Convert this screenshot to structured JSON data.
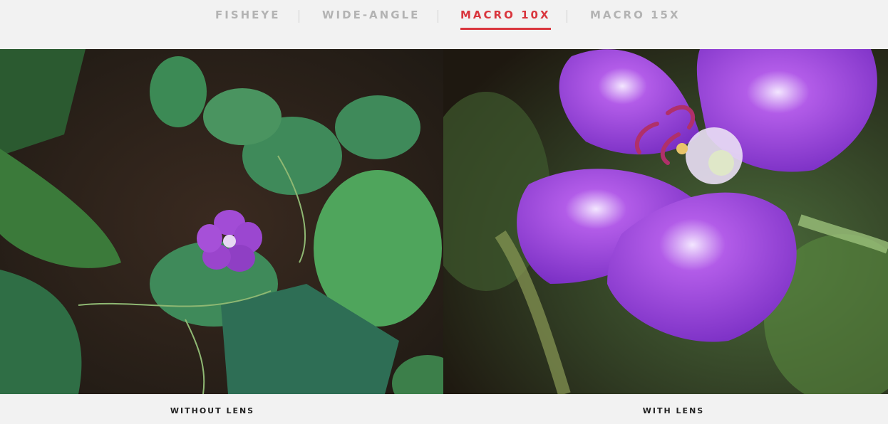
{
  "tabs": [
    {
      "label": "FISHEYE",
      "active": false
    },
    {
      "label": "WIDE-ANGLE",
      "active": false
    },
    {
      "label": "MACRO 10X",
      "active": true
    },
    {
      "label": "MACRO 15X",
      "active": false
    }
  ],
  "comparison": {
    "left_caption": "WITHOUT LENS",
    "right_caption": "WITH LENS"
  },
  "colors": {
    "accent": "#d9363e",
    "inactive_tab": "#b3b3b3",
    "background": "#f2f2f2"
  }
}
